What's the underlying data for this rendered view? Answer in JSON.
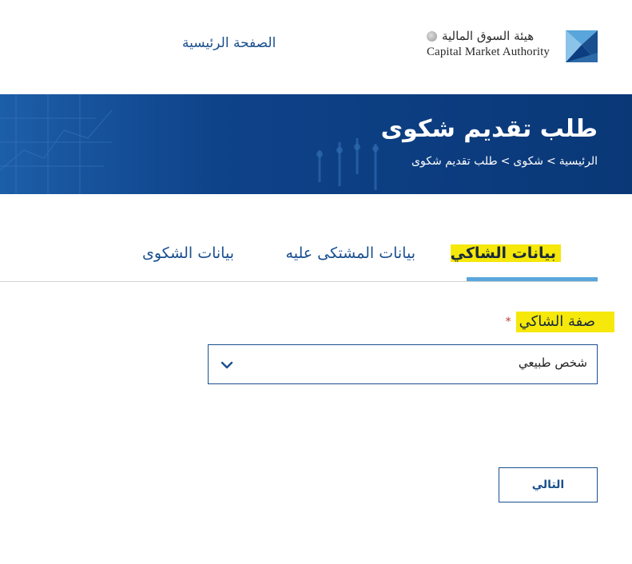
{
  "header": {
    "home_link": "الصفحة الرئيسية",
    "logo_arabic": "هيئة السوق المالية",
    "logo_english": "Capital Market Authority",
    "logo_icon": "cma-logo-mark"
  },
  "banner": {
    "title": "طلب تقديم شكوى",
    "breadcrumb": [
      "الرئيسية",
      ">",
      "شكوى",
      ">",
      "طلب تقديم شكوى"
    ]
  },
  "tabs": [
    {
      "label": "بيانات الشاكي",
      "active": true
    },
    {
      "label": "بيانات المشتكى عليه",
      "active": false
    },
    {
      "label": "بيانات الشكوى",
      "active": false
    }
  ],
  "form": {
    "complainant_type_label": "صفة الشاكي",
    "required_marker": "*",
    "complainant_type_value": "شخص طبيعي",
    "next_button": "التالي"
  },
  "colors": {
    "primary": "#0b3d80",
    "link": "#1a4f8f",
    "tab_underline": "#5aa6dc",
    "highlight": "#f5e80a"
  }
}
